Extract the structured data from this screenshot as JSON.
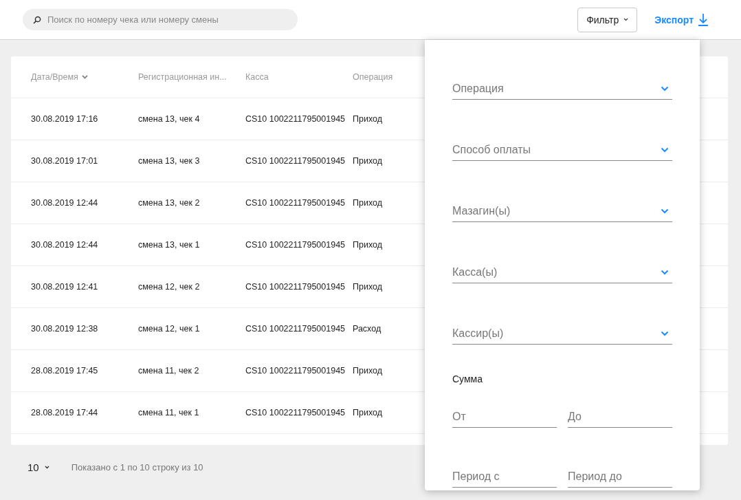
{
  "search": {
    "placeholder": "Поиск по номеру чека или номеру смены"
  },
  "filter_button": "Фильтр",
  "export_link": "Экспорт",
  "table": {
    "columns": [
      {
        "label": "Дата/Время",
        "sorted": true
      },
      {
        "label": "Регистрационная ин...",
        "sorted": false
      },
      {
        "label": "Касса",
        "sorted": false
      },
      {
        "label": "Операция",
        "sorted": false
      }
    ],
    "rows": [
      [
        "30.08.2019 17:16",
        "смена 13, чек 4",
        "CS10 1002211795001945",
        "Приход"
      ],
      [
        "30.08.2019 17:01",
        "смена 13, чек 3",
        "CS10 1002211795001945",
        "Приход"
      ],
      [
        "30.08.2019 12:44",
        "смена 13, чек 2",
        "CS10 1002211795001945",
        "Приход"
      ],
      [
        "30.08.2019 12:44",
        "смена 13, чек 1",
        "CS10 1002211795001945",
        "Приход"
      ],
      [
        "30.08.2019 12:41",
        "смена 12, чек 2",
        "CS10 1002211795001945",
        "Приход"
      ],
      [
        "30.08.2019 12:38",
        "смена 12, чек 1",
        "CS10 1002211795001945",
        "Расход"
      ],
      [
        "28.08.2019 17:45",
        "смена 11, чек 2",
        "CS10 1002211795001945",
        "Приход"
      ],
      [
        "28.08.2019 17:44",
        "смена 11, чек 1",
        "CS10 1002211795001945",
        "Приход"
      ]
    ]
  },
  "pagination": {
    "page_size": "10",
    "summary": "Показано с 1 по 10 строку из 10"
  },
  "filter_panel": {
    "selects": [
      {
        "placeholder": "Операция"
      },
      {
        "placeholder": "Способ оплаты"
      },
      {
        "placeholder": "Мазагин(ы)"
      },
      {
        "placeholder": "Касса(ы)"
      },
      {
        "placeholder": "Кассир(ы)"
      }
    ],
    "sum_label": "Сумма",
    "sum_fields": [
      {
        "placeholder": "От"
      },
      {
        "placeholder": "До"
      }
    ],
    "period_fields": [
      {
        "placeholder": "Период с"
      },
      {
        "placeholder": "Период до"
      }
    ]
  }
}
